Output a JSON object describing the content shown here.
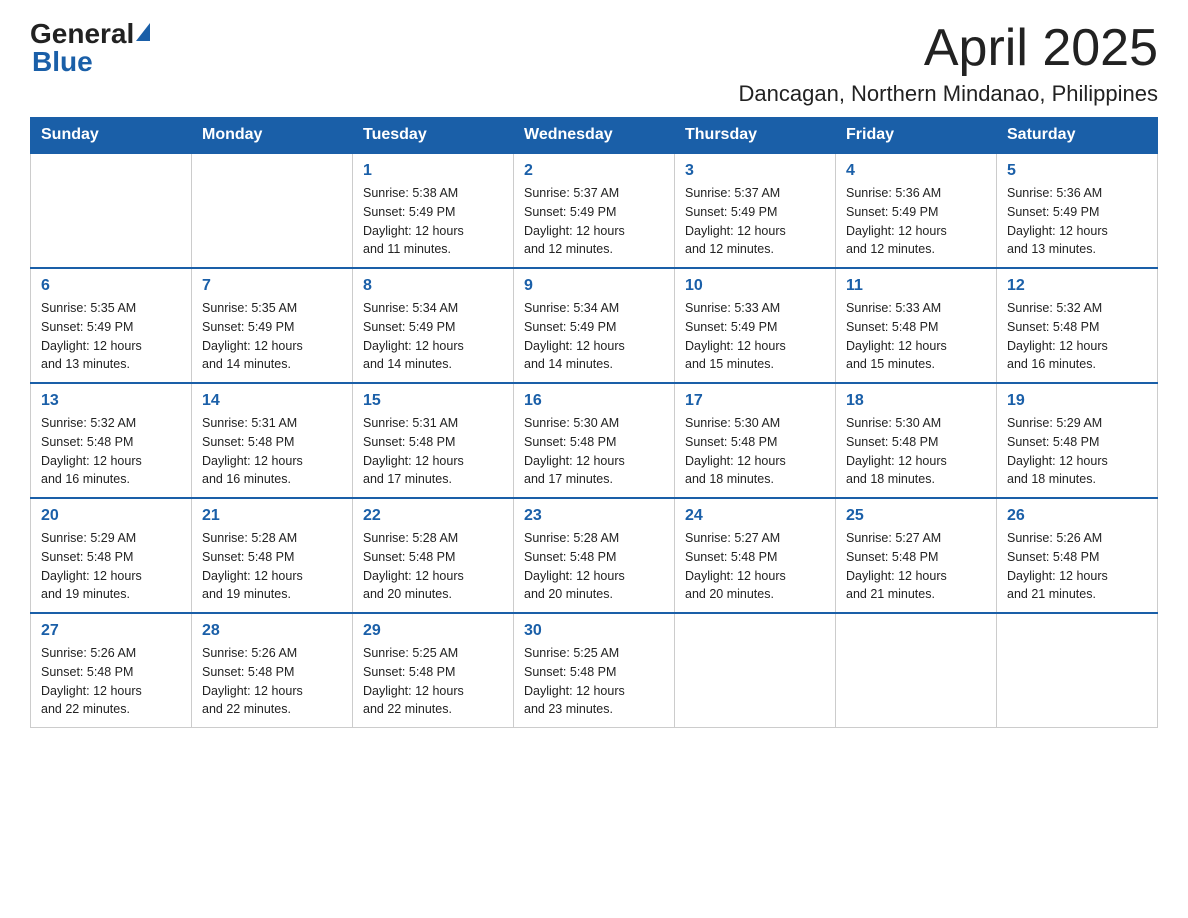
{
  "header": {
    "logo_general": "General",
    "logo_blue": "Blue",
    "month_title": "April 2025",
    "location": "Dancagan, Northern Mindanao, Philippines"
  },
  "weekdays": [
    "Sunday",
    "Monday",
    "Tuesday",
    "Wednesday",
    "Thursday",
    "Friday",
    "Saturday"
  ],
  "weeks": [
    [
      {
        "day": "",
        "info": ""
      },
      {
        "day": "",
        "info": ""
      },
      {
        "day": "1",
        "info": "Sunrise: 5:38 AM\nSunset: 5:49 PM\nDaylight: 12 hours\nand 11 minutes."
      },
      {
        "day": "2",
        "info": "Sunrise: 5:37 AM\nSunset: 5:49 PM\nDaylight: 12 hours\nand 12 minutes."
      },
      {
        "day": "3",
        "info": "Sunrise: 5:37 AM\nSunset: 5:49 PM\nDaylight: 12 hours\nand 12 minutes."
      },
      {
        "day": "4",
        "info": "Sunrise: 5:36 AM\nSunset: 5:49 PM\nDaylight: 12 hours\nand 12 minutes."
      },
      {
        "day": "5",
        "info": "Sunrise: 5:36 AM\nSunset: 5:49 PM\nDaylight: 12 hours\nand 13 minutes."
      }
    ],
    [
      {
        "day": "6",
        "info": "Sunrise: 5:35 AM\nSunset: 5:49 PM\nDaylight: 12 hours\nand 13 minutes."
      },
      {
        "day": "7",
        "info": "Sunrise: 5:35 AM\nSunset: 5:49 PM\nDaylight: 12 hours\nand 14 minutes."
      },
      {
        "day": "8",
        "info": "Sunrise: 5:34 AM\nSunset: 5:49 PM\nDaylight: 12 hours\nand 14 minutes."
      },
      {
        "day": "9",
        "info": "Sunrise: 5:34 AM\nSunset: 5:49 PM\nDaylight: 12 hours\nand 14 minutes."
      },
      {
        "day": "10",
        "info": "Sunrise: 5:33 AM\nSunset: 5:49 PM\nDaylight: 12 hours\nand 15 minutes."
      },
      {
        "day": "11",
        "info": "Sunrise: 5:33 AM\nSunset: 5:48 PM\nDaylight: 12 hours\nand 15 minutes."
      },
      {
        "day": "12",
        "info": "Sunrise: 5:32 AM\nSunset: 5:48 PM\nDaylight: 12 hours\nand 16 minutes."
      }
    ],
    [
      {
        "day": "13",
        "info": "Sunrise: 5:32 AM\nSunset: 5:48 PM\nDaylight: 12 hours\nand 16 minutes."
      },
      {
        "day": "14",
        "info": "Sunrise: 5:31 AM\nSunset: 5:48 PM\nDaylight: 12 hours\nand 16 minutes."
      },
      {
        "day": "15",
        "info": "Sunrise: 5:31 AM\nSunset: 5:48 PM\nDaylight: 12 hours\nand 17 minutes."
      },
      {
        "day": "16",
        "info": "Sunrise: 5:30 AM\nSunset: 5:48 PM\nDaylight: 12 hours\nand 17 minutes."
      },
      {
        "day": "17",
        "info": "Sunrise: 5:30 AM\nSunset: 5:48 PM\nDaylight: 12 hours\nand 18 minutes."
      },
      {
        "day": "18",
        "info": "Sunrise: 5:30 AM\nSunset: 5:48 PM\nDaylight: 12 hours\nand 18 minutes."
      },
      {
        "day": "19",
        "info": "Sunrise: 5:29 AM\nSunset: 5:48 PM\nDaylight: 12 hours\nand 18 minutes."
      }
    ],
    [
      {
        "day": "20",
        "info": "Sunrise: 5:29 AM\nSunset: 5:48 PM\nDaylight: 12 hours\nand 19 minutes."
      },
      {
        "day": "21",
        "info": "Sunrise: 5:28 AM\nSunset: 5:48 PM\nDaylight: 12 hours\nand 19 minutes."
      },
      {
        "day": "22",
        "info": "Sunrise: 5:28 AM\nSunset: 5:48 PM\nDaylight: 12 hours\nand 20 minutes."
      },
      {
        "day": "23",
        "info": "Sunrise: 5:28 AM\nSunset: 5:48 PM\nDaylight: 12 hours\nand 20 minutes."
      },
      {
        "day": "24",
        "info": "Sunrise: 5:27 AM\nSunset: 5:48 PM\nDaylight: 12 hours\nand 20 minutes."
      },
      {
        "day": "25",
        "info": "Sunrise: 5:27 AM\nSunset: 5:48 PM\nDaylight: 12 hours\nand 21 minutes."
      },
      {
        "day": "26",
        "info": "Sunrise: 5:26 AM\nSunset: 5:48 PM\nDaylight: 12 hours\nand 21 minutes."
      }
    ],
    [
      {
        "day": "27",
        "info": "Sunrise: 5:26 AM\nSunset: 5:48 PM\nDaylight: 12 hours\nand 22 minutes."
      },
      {
        "day": "28",
        "info": "Sunrise: 5:26 AM\nSunset: 5:48 PM\nDaylight: 12 hours\nand 22 minutes."
      },
      {
        "day": "29",
        "info": "Sunrise: 5:25 AM\nSunset: 5:48 PM\nDaylight: 12 hours\nand 22 minutes."
      },
      {
        "day": "30",
        "info": "Sunrise: 5:25 AM\nSunset: 5:48 PM\nDaylight: 12 hours\nand 23 minutes."
      },
      {
        "day": "",
        "info": ""
      },
      {
        "day": "",
        "info": ""
      },
      {
        "day": "",
        "info": ""
      }
    ]
  ]
}
